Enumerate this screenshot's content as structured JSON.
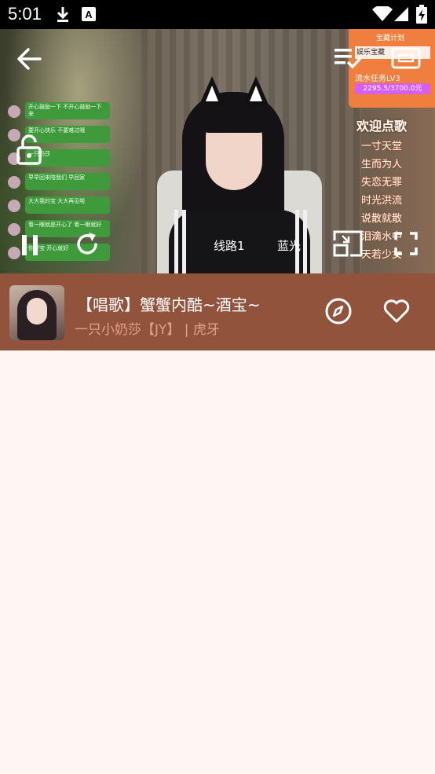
{
  "status_bar": {
    "time": "5:01",
    "icons": [
      "download-icon",
      "a-notification-icon",
      "wifi-icon",
      "signal-icon",
      "battery-charging-icon"
    ]
  },
  "video": {
    "overlay_chat": [
      "开心鼓励一下 不开心鼓励一下 来",
      "一只奶莎",
      "要开心快乐 不要难过哦",
      "小奶莎",
      "早早回来陪我们 早回家",
      "大大我的宝 大大再见啦",
      "一只奶莎",
      "看一眼就是开心了 看一眼就好",
      "一只小奶莎",
      "你好宝 开心就好"
    ],
    "side_panel": {
      "plan": "宝藏计划",
      "line1": "娱乐宝藏",
      "line2": "流水任务LV3",
      "progress": "2295.5/3700.0元"
    },
    "song_board": {
      "header": "欢迎点歌",
      "items": [
        "一寸天堂",
        "生而为人",
        "失恋无罪",
        "时光洪流",
        "说散就散",
        "泪滴水中",
        "天若少女"
      ]
    },
    "controls": {
      "route_label": "线路1",
      "quality_label": "蓝光"
    }
  },
  "stream_info": {
    "title": "【唱歌】蟹蟹内酷~酒宝~",
    "subtitle": "一只小奶莎【JY】 | 虎牙"
  },
  "colors": {
    "info_bar_bg": "#91533c",
    "page_bg": "#fff6f3",
    "subtitle": "#e2a08a"
  }
}
